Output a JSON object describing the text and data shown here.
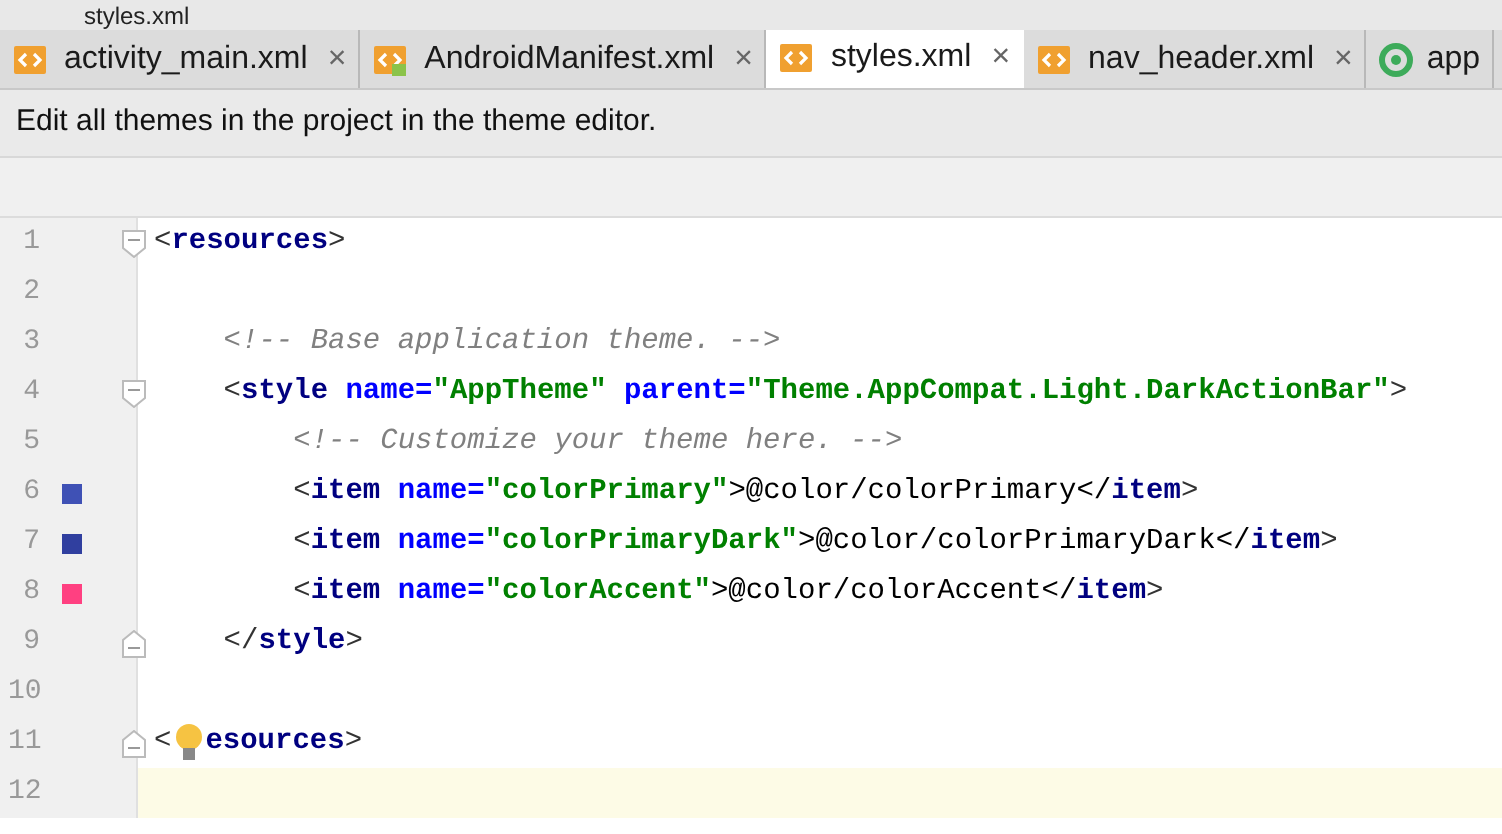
{
  "breadcrumb": "styles.xml",
  "tabs": [
    {
      "label": "activity_main.xml",
      "close": "×",
      "selected": false,
      "kind": "xml"
    },
    {
      "label": "AndroidManifest.xml",
      "close": "×",
      "selected": false,
      "kind": "manifest"
    },
    {
      "label": "styles.xml",
      "close": "×",
      "selected": true,
      "kind": "xml"
    },
    {
      "label": "nav_header.xml",
      "close": "×",
      "selected": false,
      "kind": "xml"
    },
    {
      "label": "app",
      "selected": false,
      "kind": "module"
    }
  ],
  "banner": "Edit all themes in the project in the theme editor.",
  "lines": [
    {
      "number": "1",
      "fold_start": true,
      "tokens": [
        {
          "kind": "punct",
          "text": "<"
        },
        {
          "kind": "tag",
          "text": "resources"
        },
        {
          "kind": "punct",
          "text": ">"
        }
      ]
    },
    {
      "number": "2"
    },
    {
      "number": "3",
      "tokens": [
        {
          "kind": "comment",
          "text": "    <!-- Base application theme. -->"
        }
      ]
    },
    {
      "number": "4",
      "fold_start": true,
      "tokens": [
        {
          "kind": "punct",
          "text": "    <"
        },
        {
          "kind": "tag",
          "text": "style"
        },
        {
          "kind": "attr",
          "text": " name="
        },
        {
          "kind": "value",
          "text": "\"AppTheme\""
        },
        {
          "kind": "attr",
          "text": " parent="
        },
        {
          "kind": "value",
          "text": "\"Theme.AppCompat.Light.DarkActionBar\""
        },
        {
          "kind": "punct",
          "text": ">"
        }
      ]
    },
    {
      "number": "5",
      "tokens": [
        {
          "kind": "comment",
          "text": "        <!-- Customize your theme here. -->"
        }
      ]
    },
    {
      "number": "6",
      "color": "#3f51b5",
      "tokens": [
        {
          "kind": "punct",
          "text": "        <"
        },
        {
          "kind": "tag",
          "text": "item"
        },
        {
          "kind": "attr",
          "text": " name="
        },
        {
          "kind": "value",
          "text": "\"colorPrimary\""
        },
        {
          "kind": "text",
          "text": ">@color/colorPrimary</"
        },
        {
          "kind": "tag",
          "text": "item"
        },
        {
          "kind": "punct",
          "text": ">"
        }
      ]
    },
    {
      "number": "7",
      "color": "#303f9f",
      "tokens": [
        {
          "kind": "punct",
          "text": "        <"
        },
        {
          "kind": "tag",
          "text": "item"
        },
        {
          "kind": "attr",
          "text": " name="
        },
        {
          "kind": "value",
          "text": "\"colorPrimaryDark\""
        },
        {
          "kind": "text",
          "text": ">@color/colorPrimaryDark</"
        },
        {
          "kind": "tag",
          "text": "item"
        },
        {
          "kind": "punct",
          "text": ">"
        }
      ]
    },
    {
      "number": "8",
      "color": "#ff4081",
      "tokens": [
        {
          "kind": "punct",
          "text": "        <"
        },
        {
          "kind": "tag",
          "text": "item"
        },
        {
          "kind": "attr",
          "text": " name="
        },
        {
          "kind": "value",
          "text": "\"colorAccent\""
        },
        {
          "kind": "text",
          "text": ">@color/colorAccent</"
        },
        {
          "kind": "tag",
          "text": "item"
        },
        {
          "kind": "punct",
          "text": ">"
        }
      ]
    },
    {
      "number": "9",
      "fold_end": true,
      "tokens": [
        {
          "kind": "punct",
          "text": "    </"
        },
        {
          "kind": "tag",
          "text": "style"
        },
        {
          "kind": "punct",
          "text": ">"
        }
      ]
    },
    {
      "number": "10"
    },
    {
      "number": "11",
      "fold_end": true,
      "tokens": [
        {
          "kind": "punct",
          "text": "<"
        },
        {
          "kind": "bulb"
        },
        {
          "kind": "tag",
          "text": "esources"
        },
        {
          "kind": "punct",
          "text": ">"
        }
      ]
    },
    {
      "number": "12",
      "current": true
    }
  ]
}
